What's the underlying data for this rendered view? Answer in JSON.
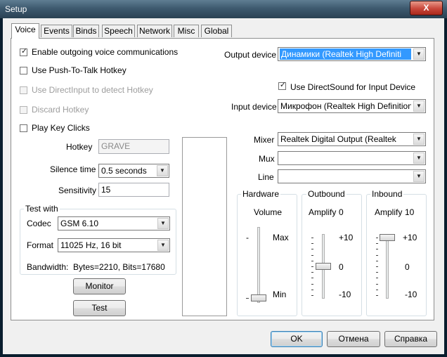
{
  "window": {
    "title": "Setup",
    "close_glyph": "X"
  },
  "tabs": [
    {
      "label": "Voice",
      "active": true
    },
    {
      "label": "Events"
    },
    {
      "label": "Binds"
    },
    {
      "label": "Speech"
    },
    {
      "label": "Network"
    },
    {
      "label": "Misc"
    },
    {
      "label": "Global"
    }
  ],
  "checkboxes": {
    "enable_voice": {
      "label": "Enable outgoing voice communications",
      "checked": true
    },
    "push_to_talk": {
      "label": "Use Push-To-Talk Hotkey",
      "checked": false
    },
    "directinput": {
      "label": "Use DirectInput to detect Hotkey",
      "checked": false,
      "disabled": true
    },
    "discard_hotkey": {
      "label": "Discard Hotkey",
      "checked": false,
      "disabled": true
    },
    "play_key_clicks": {
      "label": "Play Key Clicks",
      "checked": false
    },
    "directsound_input": {
      "label": "Use DirectSound for Input Device",
      "checked": true
    }
  },
  "hotkey": {
    "label": "Hotkey",
    "value": "GRAVE"
  },
  "silence_time": {
    "label": "Silence time",
    "value": "0.5 seconds"
  },
  "sensitivity": {
    "label": "Sensitivity",
    "value": "15"
  },
  "test_with": {
    "title": "Test with",
    "codec_label": "Codec",
    "codec_value": "GSM 6.10",
    "format_label": "Format",
    "format_value": "11025 Hz, 16 bit",
    "bandwidth_label": "Bandwidth:",
    "bandwidth_value": "Bytes=2210, Bits=17680"
  },
  "buttons": {
    "monitor": "Monitor",
    "test": "Test",
    "ok": "OK",
    "cancel": "Отмена",
    "help": "Справка"
  },
  "output_device": {
    "label": "Output device",
    "value": "Динамики (Realtek High Definiti"
  },
  "input_device": {
    "label": "Input device",
    "value": "Микрофон (Realtek High Definition Aud"
  },
  "mixer": {
    "label": "Mixer",
    "value": "Realtek Digital Output (Realtek"
  },
  "mux": {
    "label": "Mux",
    "value": ""
  },
  "line": {
    "label": "Line",
    "value": ""
  },
  "hardware": {
    "title": "Hardware",
    "volume_label": "Volume",
    "minus": "-",
    "max_label": "Max",
    "min_label": "Min",
    "level": 0.0
  },
  "outbound": {
    "title": "Outbound",
    "amplify_label": "Amplify",
    "amplify_value": "0",
    "ticks": [
      "+10",
      "0",
      "-10"
    ],
    "level": 0.5
  },
  "inbound": {
    "title": "Inbound",
    "amplify_label": "Amplify",
    "amplify_value": "10",
    "ticks": [
      "+10",
      "0",
      "-10"
    ],
    "level": 1.0
  },
  "icons": {
    "checkmark": "✓",
    "dropdown_arrow": "▼"
  }
}
